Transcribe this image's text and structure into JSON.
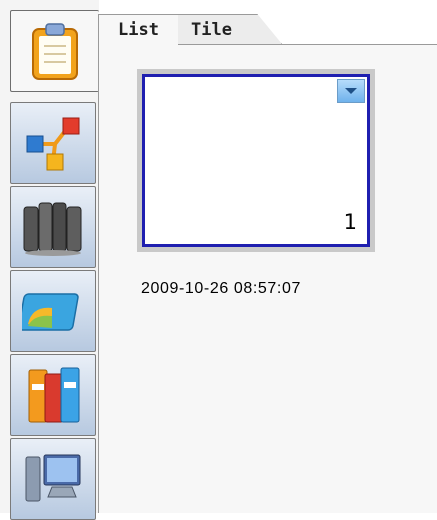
{
  "sidebar": {
    "items": [
      {
        "icon": "clipboard-icon",
        "active": true
      },
      {
        "icon": "network-icon",
        "active": false
      },
      {
        "icon": "library-books-icon",
        "active": false
      },
      {
        "icon": "card-icon",
        "active": false
      },
      {
        "icon": "binders-icon",
        "active": false
      },
      {
        "icon": "computer-icon",
        "active": false
      }
    ]
  },
  "tabs": [
    {
      "label": "List",
      "active": true
    },
    {
      "label": "Tile",
      "active": false
    }
  ],
  "thumbnail": {
    "page_number": "1",
    "timestamp": "2009-10-26 08:57:07",
    "selected": true,
    "border_color": "#1f1fb0"
  }
}
